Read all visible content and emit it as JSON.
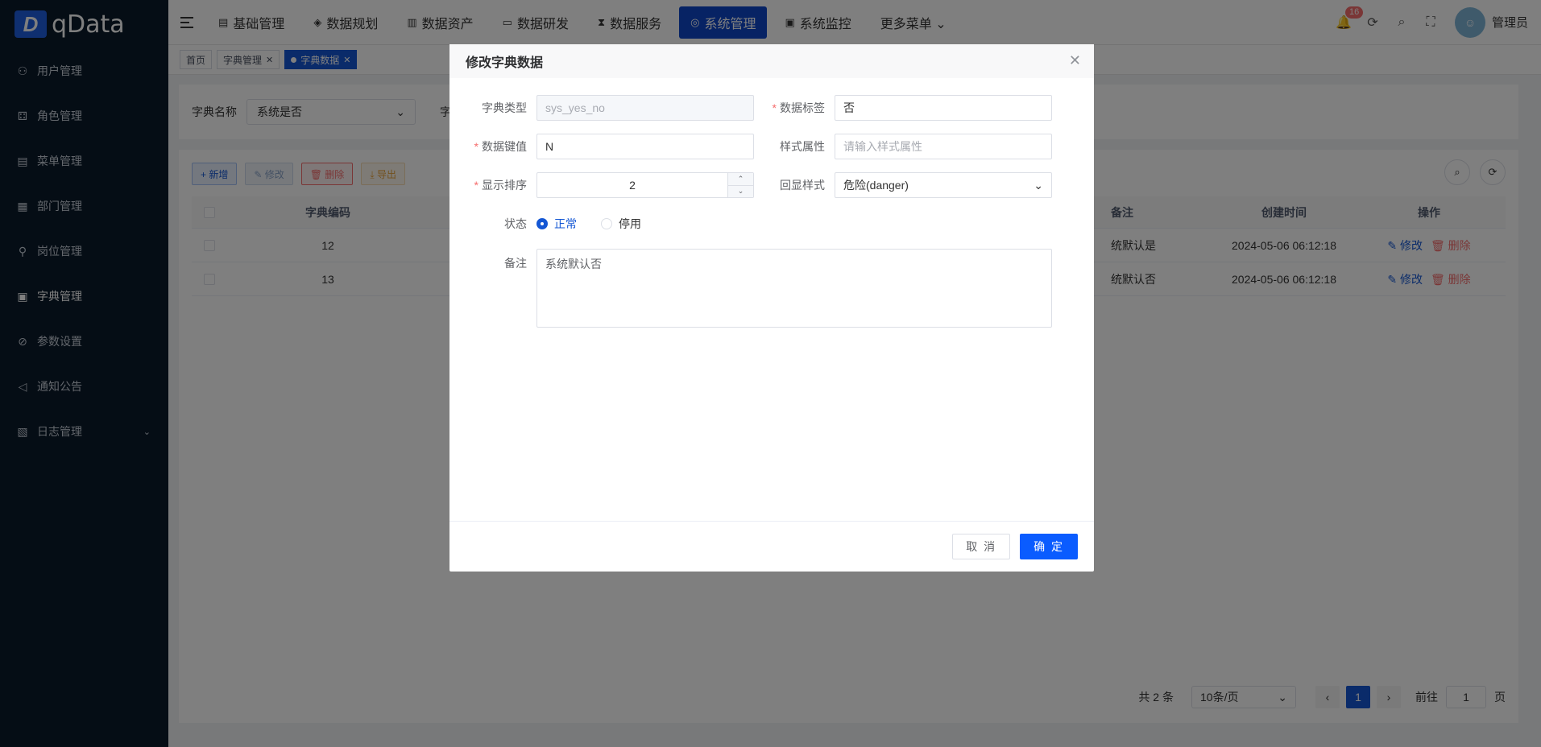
{
  "app": {
    "logo_letter": "D",
    "name": "qData"
  },
  "sidebar": {
    "items": [
      {
        "label": "用户管理",
        "icon": "user-icon"
      },
      {
        "label": "角色管理",
        "icon": "role-icon"
      },
      {
        "label": "菜单管理",
        "icon": "menu-icon"
      },
      {
        "label": "部门管理",
        "icon": "dept-icon"
      },
      {
        "label": "岗位管理",
        "icon": "post-icon"
      },
      {
        "label": "字典管理",
        "icon": "dict-icon"
      },
      {
        "label": "参数设置",
        "icon": "param-icon"
      },
      {
        "label": "通知公告",
        "icon": "notice-icon"
      },
      {
        "label": "日志管理",
        "icon": "log-icon"
      }
    ]
  },
  "topnav": {
    "items": [
      {
        "label": "基础管理",
        "icon": "▤"
      },
      {
        "label": "数据规划",
        "icon": "◈"
      },
      {
        "label": "数据资产",
        "icon": "▥"
      },
      {
        "label": "数据研发",
        "icon": "▭"
      },
      {
        "label": "数据服务",
        "icon": "⧗"
      },
      {
        "label": "系统管理",
        "icon": "◎"
      },
      {
        "label": "系统监控",
        "icon": "▣"
      },
      {
        "label": "更多菜单 ⌄",
        "icon": ""
      }
    ]
  },
  "header": {
    "badge_count": "16",
    "username": "管理员"
  },
  "tags": [
    {
      "label": "首页"
    },
    {
      "label": "字典管理"
    },
    {
      "label": "字典数据"
    }
  ],
  "search": {
    "label": "字典名称",
    "value": "系统是否",
    "label2": "字"
  },
  "toolbar": {
    "add": "+ 新增",
    "edit": "✎ 修改",
    "delete": "🗑 删除",
    "export": "⤓ 导出"
  },
  "table": {
    "headers": {
      "code": "字典编码",
      "note": "备注",
      "time": "创建时间",
      "op": "操作"
    },
    "rows": [
      {
        "code": "12",
        "note": "统默认是",
        "time": "2024-05-06 06:12:18",
        "edit": "修改",
        "delete": "删除"
      },
      {
        "code": "13",
        "note": "统默认否",
        "time": "2024-05-06 06:12:18",
        "edit": "修改",
        "delete": "删除"
      }
    ]
  },
  "pager": {
    "total": "共 2 条",
    "size": "10条/页",
    "page": "1",
    "goto": "前往",
    "goto_value": "1",
    "unit": "页"
  },
  "dialog": {
    "title": "修改字典数据",
    "fields": {
      "dict_type_label": "字典类型",
      "dict_type_value": "sys_yes_no",
      "data_label_label": "数据标签",
      "data_label_value": "否",
      "data_value_label": "数据键值",
      "data_value_value": "N",
      "css_label": "样式属性",
      "css_placeholder": "请输入样式属性",
      "sort_label": "显示排序",
      "sort_value": "2",
      "list_class_label": "回显样式",
      "list_class_value": "危险(danger)",
      "status_label": "状态",
      "status_on": "正常",
      "status_off": "停用",
      "remark_label": "备注",
      "remark_value": "系统默认否"
    },
    "cancel": "取 消",
    "confirm": "确 定"
  }
}
